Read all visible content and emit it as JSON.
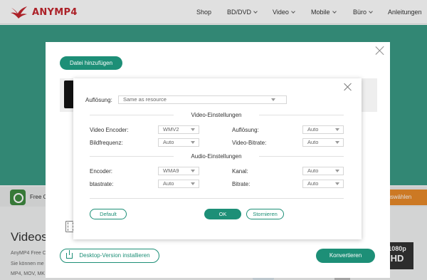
{
  "nav": {
    "brand": "ANYMP4",
    "items": [
      "Shop",
      "BD/DVD",
      "Video",
      "Mobile",
      "Büro",
      "Anleitungen"
    ]
  },
  "background_page": {
    "strip_text": "Free C",
    "strip_button": "Dateien auswählen",
    "strip_button_visible": "auswählen",
    "heading": "Videos k",
    "paragraph_lines": [
      "AnyMP4 Free C",
      "Sie können me",
      "MP4, MOV, MK"
    ],
    "thumb_lines": [
      "1080p",
      "HD"
    ]
  },
  "converter": {
    "add_file_label": "Datei hinzufügen",
    "desktop_button_label": "Desktop-Version installieren",
    "convert_button_label": "Konvertieren"
  },
  "dialog": {
    "resolution_label": "Auflösung:",
    "resolution_value": "Same as resource",
    "video_section_title": "Video-Einstellungen",
    "video": {
      "encoder_label": "Video Encoder:",
      "encoder_value": "WMV2",
      "resolution_label": "Auflösung:",
      "resolution_value": "Auto",
      "framerate_label": "Bildfrequenz:",
      "framerate_value": "Auto",
      "bitrate_label": "Video-Bitrate:",
      "bitrate_value": "Auto"
    },
    "audio_section_title": "Audio-Einstellungen",
    "audio": {
      "encoder_label": "Encoder:",
      "encoder_value": "WMA9",
      "channel_label": "Kanal:",
      "channel_value": "Auto",
      "samplerate_label": "btastrate:",
      "samplerate_value": "Auto",
      "bitrate_label": "Bitrate:",
      "bitrate_value": "Auto"
    },
    "default_button": "Default",
    "ok_button": "OK",
    "cancel_button": "Stornieren"
  },
  "colors": {
    "brand_red": "#c4262e",
    "accent_green": "#1d8f77",
    "hero_teal": "#3a9a85",
    "orange": "#e98a2a"
  }
}
